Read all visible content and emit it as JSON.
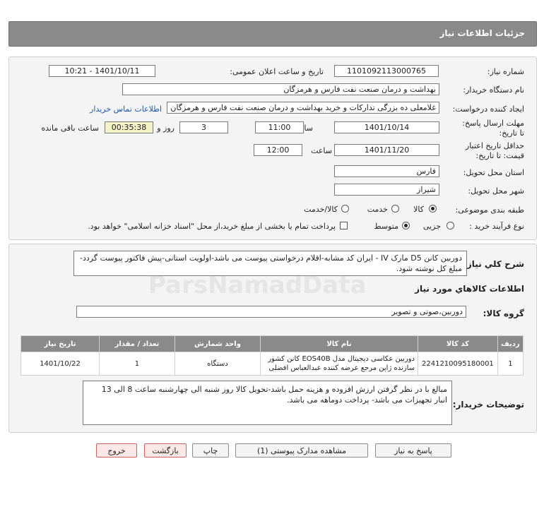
{
  "header": {
    "title": "جزئیات اطلاعات نیاز"
  },
  "form": {
    "need_number_label": "شماره نیاز:",
    "need_number": "1101092113000765",
    "announce_label": "تاریخ و ساعت اعلان عمومی:",
    "announce_value": "1401/10/11 - 10:21",
    "buyer_org_label": "نام دستگاه خریدار:",
    "buyer_org": "بهداشت و درمان صنعت نفت فارس و هرمزگان",
    "creator_label": "ایجاد کننده درخواست:",
    "creator": "غلامعلی ده بزرگی تدارکات و خرید بهداشت و درمان صنعت نفت فارس و هرمزگان",
    "contact_link": "اطلاعات تماس خریدار",
    "reply_deadline_label": "مهلت ارسال پاسخ: تا تاریخ:",
    "reply_date": "1401/10/14",
    "time_label": "ساعت",
    "reply_time": "11:00",
    "days_value": "3",
    "days_label": "روز و",
    "remaining_time": "00:35:38",
    "remaining_label": "ساعت باقی مانده",
    "validity_label": "حداقل تاریخ اعتبار قیمت: تا تاریخ:",
    "validity_date": "1401/11/20",
    "validity_time_label": "ساعت",
    "validity_time": "12:00",
    "province_label": "استان محل تحویل:",
    "province": "فارس",
    "city_label": "شهر محل تحویل:",
    "city": "شیراز",
    "category_label": "طبقه بندی موضوعی:",
    "category_options": [
      "کالا",
      "خدمت",
      "کالا/خدمت"
    ],
    "process_label": "نوع فرآیند خرید :",
    "process_options": [
      "جزیی",
      "متوسط"
    ],
    "payment_note": "پرداخت تمام یا بخشی از مبلغ خرید،از محل \"اسناد خزانه اسلامی\" خواهد بود."
  },
  "summary": {
    "label": "شرح کلي نياز:",
    "text": "دوربین کانن D5 مارک IV - ایران کد مشابه-اقلام درخواستی پیوست می باشد-اولویت استانی-پیش فاکتور پیوست گردد-مبلغ کل نوشته شود."
  },
  "goods": {
    "section_title": "اطلاعات کالاهاي مورد نياز",
    "group_label": "گروه کالا:",
    "group_value": "دوربین،صوتی و تصویر",
    "columns": [
      "ردیف",
      "کد کالا",
      "نام کالا",
      "واحد شمارش",
      "تعداد / مقدار",
      "تاریخ نیاز"
    ],
    "rows": [
      {
        "index": "1",
        "code": "2241210095180001",
        "name": "دوربین عکاسی دیجیتال مدل EOS40B کانن کشور سازنده ژاپن مرجع عرضه کننده عبدالعباس افضلی",
        "unit": "دستگاه",
        "qty": "1",
        "date": "1401/10/22"
      }
    ]
  },
  "buyer_notes": {
    "label": "توضیحات خریدار:",
    "text": "مبالغ با در نظر گرفتن ارزش افزوده و هزینه حمل باشد-تحویل کالا روز شنبه الی چهارشنبه ساعت 8 الی 13 انبار تجهیزات می باشد- پرداخت دوماهه می باشد."
  },
  "buttons": {
    "reply": "پاسخ به نیاز",
    "attachments": "مشاهده مدارک پیوستی (1)",
    "print": "چاپ",
    "back": "بازگشت",
    "exit": "خروج"
  },
  "colors": {
    "header_bg": "#8a8a8a",
    "link": "#1a55b8",
    "remaining_bg": "#f2f2c6"
  }
}
